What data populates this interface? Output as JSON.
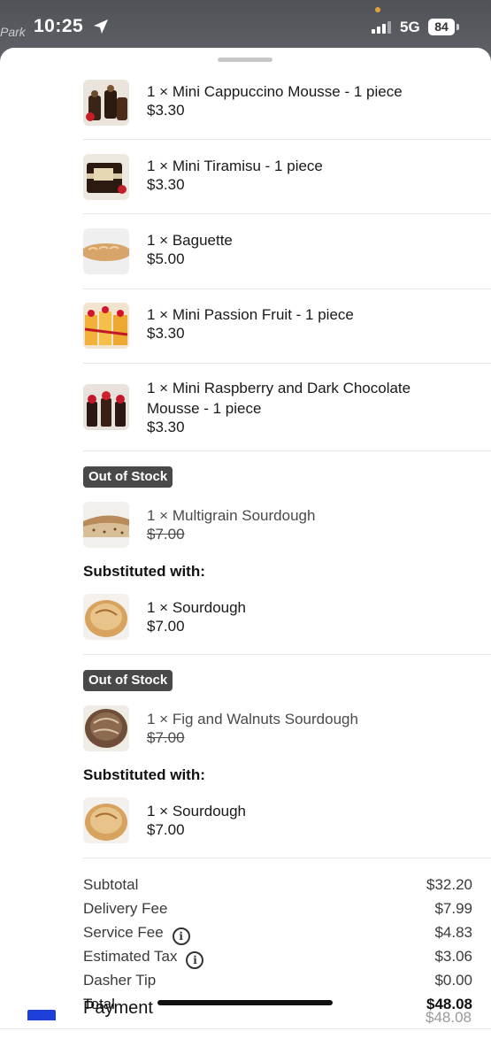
{
  "status_bar": {
    "time": "10:25",
    "network": "5G",
    "battery": "84",
    "map_label": "Park"
  },
  "items": [
    {
      "name": "1 × Mini Cappuccino Mousse - 1 piece",
      "price": "$3.30"
    },
    {
      "name": "1 × Mini Tiramisu - 1 piece",
      "price": "$3.30"
    },
    {
      "name": "1 × Baguette",
      "price": "$5.00"
    },
    {
      "name": "1 × Mini Passion Fruit - 1 piece",
      "price": "$3.30"
    },
    {
      "name": "1 × Mini Raspberry and Dark Chocolate Mousse - 1 piece",
      "price": "$3.30"
    }
  ],
  "substitutions": [
    {
      "badge": "Out of Stock",
      "original_name": "1 × Multigrain Sourdough",
      "original_price": "$7.00",
      "label": "Substituted with:",
      "new_name": "1 × Sourdough",
      "new_price": "$7.00"
    },
    {
      "badge": "Out of Stock",
      "original_name": "1 × Fig and Walnuts Sourdough",
      "original_price": "$7.00",
      "label": "Substituted with:",
      "new_name": "1 × Sourdough",
      "new_price": "$7.00"
    }
  ],
  "summary": {
    "subtotal_label": "Subtotal",
    "subtotal": "$32.20",
    "delivery_label": "Delivery Fee",
    "delivery": "$7.99",
    "service_label": "Service Fee",
    "service": "$4.83",
    "tax_label": "Estimated Tax",
    "tax": "$3.06",
    "tip_label": "Dasher Tip",
    "tip": "$0.00",
    "total_label": "Total",
    "total": "$48.08"
  },
  "payment": {
    "label": "Payment",
    "amount": "$48.08"
  }
}
